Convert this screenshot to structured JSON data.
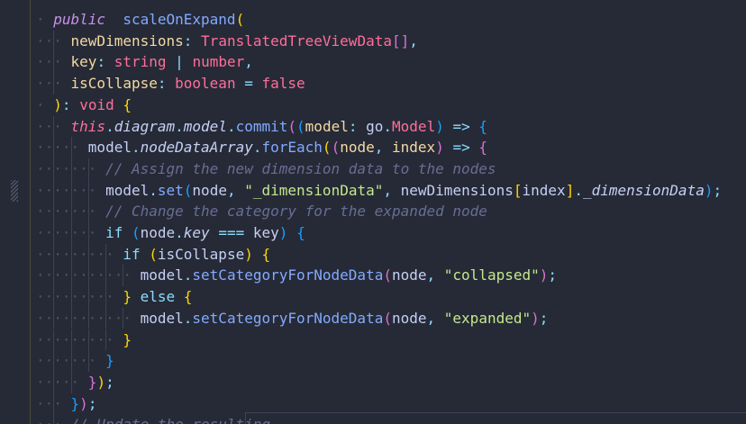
{
  "editor": {
    "language": "typescript",
    "lines": [
      {
        "indent": 1,
        "tokens": [
          [
            "kw",
            "public"
          ],
          [
            "",
            "  "
          ],
          [
            "fn",
            "scaleOnExpand"
          ],
          [
            "br1",
            "("
          ]
        ]
      },
      {
        "indent": 2,
        "tokens": [
          [
            "param",
            "newDimensions"
          ],
          [
            "pun",
            ":"
          ],
          [
            "",
            " "
          ],
          [
            "type",
            "TranslatedTreeViewData"
          ],
          [
            "br2",
            "["
          ],
          [
            "br2",
            "]"
          ],
          [
            "pun",
            ","
          ]
        ]
      },
      {
        "indent": 2,
        "tokens": [
          [
            "param",
            "key"
          ],
          [
            "pun",
            ":"
          ],
          [
            "",
            " "
          ],
          [
            "type",
            "string"
          ],
          [
            "",
            " "
          ],
          [
            "pun",
            "|"
          ],
          [
            "",
            " "
          ],
          [
            "type",
            "number"
          ],
          [
            "pun",
            ","
          ]
        ]
      },
      {
        "indent": 2,
        "tokens": [
          [
            "param",
            "isCollapse"
          ],
          [
            "pun",
            ":"
          ],
          [
            "",
            " "
          ],
          [
            "type",
            "boolean"
          ],
          [
            "",
            " "
          ],
          [
            "op",
            "="
          ],
          [
            "",
            " "
          ],
          [
            "bool",
            "false"
          ]
        ]
      },
      {
        "indent": 1,
        "tokens": [
          [
            "br1",
            ")"
          ],
          [
            "pun",
            ":"
          ],
          [
            "",
            " "
          ],
          [
            "type",
            "void"
          ],
          [
            "",
            " "
          ],
          [
            "br1",
            "{"
          ]
        ]
      },
      {
        "indent": 2,
        "tokens": [
          [
            "this",
            "this"
          ],
          [
            "pun",
            "."
          ],
          [
            "ital",
            "diagram"
          ],
          [
            "pun",
            "."
          ],
          [
            "ital",
            "model"
          ],
          [
            "pun",
            "."
          ],
          [
            "fn",
            "commit"
          ],
          [
            "br2",
            "("
          ],
          [
            "br3",
            "("
          ],
          [
            "param",
            "model"
          ],
          [
            "pun",
            ":"
          ],
          [
            "",
            " "
          ],
          [
            "prop",
            "go"
          ],
          [
            "pun",
            "."
          ],
          [
            "type",
            "Model"
          ],
          [
            "br3",
            ")"
          ],
          [
            "",
            " "
          ],
          [
            "op",
            "=>"
          ],
          [
            "",
            " "
          ],
          [
            "br3",
            "{"
          ]
        ]
      },
      {
        "indent": 3,
        "tokens": [
          [
            "prop",
            "model"
          ],
          [
            "pun",
            "."
          ],
          [
            "ital",
            "nodeDataArray"
          ],
          [
            "pun",
            "."
          ],
          [
            "fn",
            "forEach"
          ],
          [
            "br1",
            "("
          ],
          [
            "br2",
            "("
          ],
          [
            "param",
            "node"
          ],
          [
            "pun",
            ","
          ],
          [
            "",
            " "
          ],
          [
            "param",
            "index"
          ],
          [
            "br2",
            ")"
          ],
          [
            "",
            " "
          ],
          [
            "op",
            "=>"
          ],
          [
            "",
            " "
          ],
          [
            "br2",
            "{"
          ]
        ]
      },
      {
        "indent": 4,
        "tokens": [
          [
            "cm",
            "// Assign the new dimension data to the nodes"
          ]
        ]
      },
      {
        "indent": 4,
        "tokens": [
          [
            "prop",
            "model"
          ],
          [
            "pun",
            "."
          ],
          [
            "fn",
            "set"
          ],
          [
            "br3",
            "("
          ],
          [
            "prop",
            "node"
          ],
          [
            "pun",
            ","
          ],
          [
            "",
            " "
          ],
          [
            "str",
            "\"_dimensionData\""
          ],
          [
            "pun",
            ","
          ],
          [
            "",
            " "
          ],
          [
            "prop",
            "newDimensions"
          ],
          [
            "br1",
            "["
          ],
          [
            "prop",
            "index"
          ],
          [
            "br1",
            "]"
          ],
          [
            "pun",
            "."
          ],
          [
            "ital",
            "_dimensionData"
          ],
          [
            "br3",
            ")"
          ],
          [
            "pun",
            ";"
          ]
        ]
      },
      {
        "indent": 4,
        "tokens": [
          [
            "cm",
            "// Change the category for the expanded node"
          ]
        ]
      },
      {
        "indent": 4,
        "tokens": [
          [
            "kw2",
            "if"
          ],
          [
            "",
            " "
          ],
          [
            "br3",
            "("
          ],
          [
            "prop",
            "node"
          ],
          [
            "pun",
            "."
          ],
          [
            "ital",
            "key"
          ],
          [
            "",
            " "
          ],
          [
            "op",
            "==="
          ],
          [
            "",
            " "
          ],
          [
            "prop",
            "key"
          ],
          [
            "br3",
            ")"
          ],
          [
            "",
            " "
          ],
          [
            "br3",
            "{"
          ]
        ]
      },
      {
        "indent": 5,
        "tokens": [
          [
            "kw2",
            "if"
          ],
          [
            "",
            " "
          ],
          [
            "br1",
            "("
          ],
          [
            "prop",
            "isCollapse"
          ],
          [
            "br1",
            ")"
          ],
          [
            "",
            " "
          ],
          [
            "br1",
            "{"
          ]
        ]
      },
      {
        "indent": 6,
        "tokens": [
          [
            "prop",
            "model"
          ],
          [
            "pun",
            "."
          ],
          [
            "fn",
            "setCategoryForNodeData"
          ],
          [
            "br2",
            "("
          ],
          [
            "prop",
            "node"
          ],
          [
            "pun",
            ","
          ],
          [
            "",
            " "
          ],
          [
            "str",
            "\"collapsed\""
          ],
          [
            "br2",
            ")"
          ],
          [
            "pun",
            ";"
          ]
        ]
      },
      {
        "indent": 5,
        "tokens": [
          [
            "br1",
            "}"
          ],
          [
            "",
            " "
          ],
          [
            "kw2",
            "else"
          ],
          [
            "",
            " "
          ],
          [
            "br1",
            "{"
          ]
        ]
      },
      {
        "indent": 6,
        "tokens": [
          [
            "prop",
            "model"
          ],
          [
            "pun",
            "."
          ],
          [
            "fn",
            "setCategoryForNodeData"
          ],
          [
            "br2",
            "("
          ],
          [
            "prop",
            "node"
          ],
          [
            "pun",
            ","
          ],
          [
            "",
            " "
          ],
          [
            "str",
            "\"expanded\""
          ],
          [
            "br2",
            ")"
          ],
          [
            "pun",
            ";"
          ]
        ]
      },
      {
        "indent": 5,
        "tokens": [
          [
            "br1",
            "}"
          ]
        ]
      },
      {
        "indent": 4,
        "tokens": [
          [
            "br3",
            "}"
          ]
        ]
      },
      {
        "indent": 3,
        "tokens": [
          [
            "br2",
            "}"
          ],
          [
            "br1",
            ")"
          ],
          [
            "pun",
            ";"
          ]
        ]
      },
      {
        "indent": 2,
        "tokens": [
          [
            "br3",
            "}"
          ],
          [
            "br2",
            ")"
          ],
          [
            "pun",
            ";"
          ]
        ]
      },
      {
        "indent": 2,
        "tokens": [
          [
            "cm",
            "// Update the resulting"
          ]
        ]
      }
    ],
    "colors": {
      "background": "#262a36",
      "comment": "#676e95",
      "string": "#c3e88d",
      "function": "#82aaff",
      "keyword": "#c792ea",
      "type": "#ff6e9c"
    }
  }
}
